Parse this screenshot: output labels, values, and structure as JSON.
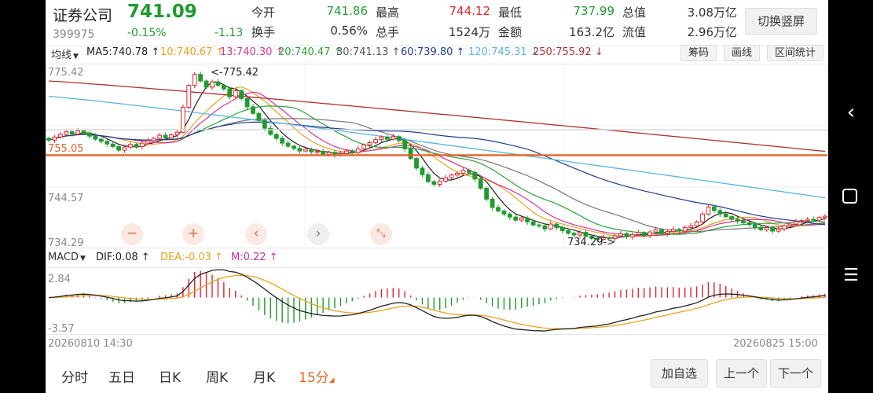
{
  "stock": {
    "name": "证券公司",
    "price": "741.09",
    "code": "399975",
    "change_pct": "-0.15%",
    "change": "-1.13"
  },
  "quote": {
    "row1": [
      {
        "label": "今开",
        "value": "741.86",
        "color": "#1f9b2f"
      },
      {
        "label": "最高",
        "value": "744.12",
        "color": "#e0242c"
      },
      {
        "label": "最低",
        "value": "737.99",
        "color": "#1f9b2f"
      },
      {
        "label": "总值",
        "value": "3.08万亿",
        "color": "#333333"
      }
    ],
    "row2": [
      {
        "label": "换手",
        "value": "0.56%",
        "color": "#333333"
      },
      {
        "label": "总手",
        "value": "1524万",
        "color": "#333333"
      },
      {
        "label": "金额",
        "value": "163.2亿",
        "color": "#333333"
      },
      {
        "label": "流值",
        "value": "2.96万亿",
        "color": "#333333"
      }
    ],
    "switch_button": "切换竖屏"
  },
  "ma_bar": {
    "selector": "均线",
    "items": [
      {
        "text": "MA5:740.78",
        "color": "#222222",
        "arrow": "↑"
      },
      {
        "text": "10:740.67",
        "color": "#e8a21e",
        "arrow": "↑"
      },
      {
        "text": "13:740.30",
        "color": "#d6339a",
        "arrow": "↑"
      },
      {
        "text": "20:740.47",
        "color": "#2ba33a",
        "arrow": "↑"
      },
      {
        "text": "30:741.13",
        "color": "#555555",
        "arrow": "↑"
      },
      {
        "text": "60:739.80",
        "color": "#1f3c8c",
        "arrow": "↑"
      },
      {
        "text": "120:745.31",
        "color": "#5bb4e0",
        "arrow": "↓"
      },
      {
        "text": "250:755.92",
        "color": "#b03030",
        "arrow": "↓"
      }
    ],
    "buttons": [
      "筹码",
      "画线",
      "区间统计"
    ]
  },
  "main_chart": {
    "y_max_label": "775.42",
    "y_mid_label": "744.57",
    "y_min_label": "734.29",
    "ref_line_label": "755.05",
    "ref_line_color": "#e2652a",
    "high_annotation": "<-775.42",
    "low_annotation": "734.29->",
    "controls": [
      "minus-icon",
      "plus-icon",
      "chevron-left-icon",
      "chevron-right-icon",
      "collapse-icon"
    ]
  },
  "macd": {
    "selector": "MACD",
    "dif": "DIF:0.08",
    "dea": "DEA:-0.03",
    "m": "M:0.22",
    "dif_color": "#222222",
    "dea_color": "#e8a21e",
    "m_color": "#c2309a",
    "top_label": "2.84",
    "bottom_label": "-3.57"
  },
  "time_axis": {
    "start": "20260810 14:30",
    "end": "20260825 15:00"
  },
  "tabs": [
    {
      "label": "分时",
      "active": false
    },
    {
      "label": "五日",
      "active": false
    },
    {
      "label": "日K",
      "active": false
    },
    {
      "label": "周K",
      "active": false
    },
    {
      "label": "月K",
      "active": false
    },
    {
      "label": "15分",
      "active": true
    }
  ],
  "bottom_buttons": [
    "加自选",
    "上一个",
    "下一个"
  ],
  "chart_data": {
    "type": "candlestick",
    "interval": "15分",
    "y_range": [
      734.29,
      775.42
    ],
    "start_time": "20260810 14:30",
    "end_time": "20260825 15:00",
    "reference_line": 755.05,
    "close_series": [
      758.5,
      759.2,
      759.8,
      760.4,
      759.9,
      760.6,
      760.1,
      759.4,
      758.7,
      758.2,
      757.6,
      757.0,
      756.2,
      756.9,
      757.5,
      757.0,
      757.8,
      758.4,
      758.9,
      759.6,
      759.0,
      759.7,
      760.3,
      766.0,
      771.0,
      773.5,
      772.0,
      770.6,
      771.8,
      771.0,
      770.2,
      768.4,
      769.8,
      768.0,
      766.1,
      764.6,
      763.0,
      761.2,
      759.8,
      758.9,
      757.8,
      757.1,
      756.6,
      756.0,
      756.4,
      755.8,
      755.9,
      755.2,
      755.7,
      755.1,
      755.4,
      756.0,
      755.6,
      756.5,
      757.4,
      757.9,
      758.6,
      759.2,
      758.7,
      759.3,
      758.4,
      756.5,
      754.3,
      752.1,
      750.6,
      749.0,
      748.4,
      749.1,
      749.9,
      750.5,
      750.9,
      751.6,
      751.1,
      749.6,
      747.5,
      745.0,
      743.1,
      742.3,
      741.6,
      740.9,
      740.2,
      740.7,
      739.8,
      739.1,
      738.9,
      738.2,
      739.3,
      738.5,
      737.8,
      737.2,
      736.8,
      737.4,
      736.5,
      736.1,
      735.8,
      736.2,
      736.0,
      736.6,
      737.1,
      736.4,
      736.9,
      737.4,
      736.7,
      737.5,
      738.0,
      737.2,
      737.6,
      738.1,
      737.7,
      738.5,
      738.9,
      739.8,
      741.6,
      743.2,
      742.4,
      741.6,
      741.0,
      740.4,
      740.0,
      739.6,
      739.2,
      738.6,
      738.0,
      738.5,
      737.7,
      738.2,
      738.9,
      739.3,
      739.9,
      740.1,
      740.4,
      740.2,
      740.8,
      741.09
    ],
    "ma_series": [
      {
        "name": "MA5",
        "value": 740.78
      },
      {
        "name": "10",
        "value": 740.67
      },
      {
        "name": "13",
        "value": 740.3
      },
      {
        "name": "20",
        "value": 740.47
      },
      {
        "name": "30",
        "value": 741.13
      },
      {
        "name": "60",
        "value": 739.8
      },
      {
        "name": "120",
        "value": 745.31
      },
      {
        "name": "250",
        "value": 755.92
      }
    ],
    "macd_range": [
      -3.57,
      2.84
    ],
    "macd": {
      "DIF": 0.08,
      "DEA": -0.03,
      "M": 0.22
    }
  }
}
